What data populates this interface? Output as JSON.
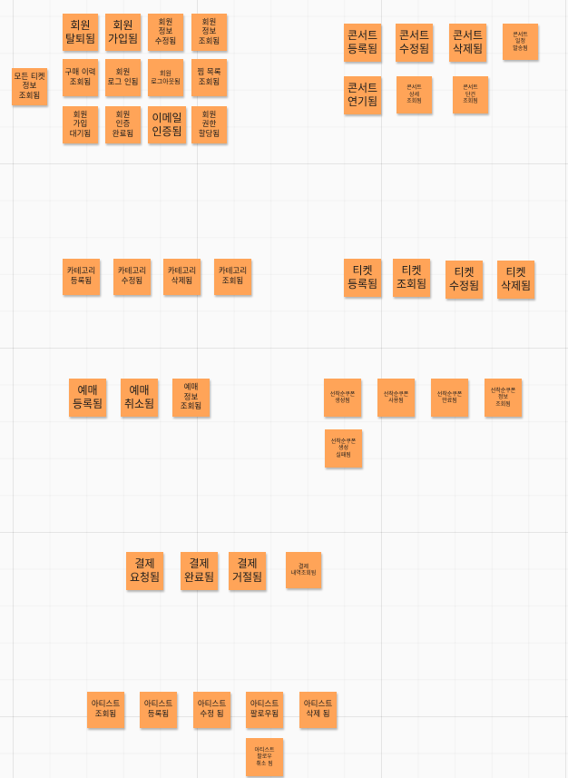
{
  "board": {
    "sticky_color": "#ffa458",
    "background_color": "#fafafa"
  },
  "stickies": {
    "member_withdrawn": "회원\n탈퇴됨",
    "member_joined": "회원\n가입됨",
    "member_info_modified": "회원\n정보\n수정됨",
    "member_info_viewed": "회원\n정보\n조회됨",
    "my_ticket_info_viewed": "모든 티켓\n정보\n조회됨",
    "purchase_history_viewed": "구매 이력\n조회됨",
    "member_logout_requested": "회원\n로그 인됨",
    "member_logged_out": "회원\n로그아웃됨",
    "favorite_list_viewed": "찜 목록\n조회됨",
    "member_signup_pending": "회원\n가입\n대기됨",
    "member_auth_completed": "회원\n인증\n완료됨",
    "email_verified": "이메일\n인증됨",
    "member_permission_assigned": "회원\n권한\n할당됨",
    "concert_registered": "콘서트\n등록됨",
    "concert_modified": "콘서트\n수정됨",
    "concert_deleted": "콘서트\n삭제됨",
    "concert_schedule_set": "콘서트\n일정\n발송됨",
    "concert_postponed": "콘서트\n연기됨",
    "concert_detail_viewed": "콘서트\n상세\n조회됨",
    "concert_list_viewed": "콘서트\n단건\n조회됨",
    "category_registered": "카테고리\n등록됨",
    "category_modified": "카테고리\n수정됨",
    "category_deleted": "카테고리\n삭제됨",
    "category_viewed": "카테고리\n조회됨",
    "ticket_registered": "티켓\n등록됨",
    "ticket_viewed": "티켓\n조회됨",
    "ticket_modified": "티켓\n수정됨",
    "ticket_deleted": "티켓\n삭제됨",
    "reservation_registered": "예매\n등록됨",
    "reservation_cancelled": "예매\n취소됨",
    "reservation_info_viewed": "예매\n정보\n조회됨",
    "coupon_created": "선착순쿠폰\n생성됨",
    "coupon_used": "선착순쿠폰\n사용됨",
    "coupon_cancelled": "선착순쿠폰\n만료됨",
    "coupon_info_viewed": "선착순쿠폰\n정보\n조회됨",
    "coupon_issue_failed": "선착순쿠폰\n생성\n실패됨",
    "payment_requested": "결제\n요청됨",
    "payment_completed": "결제\n완료됨",
    "payment_rejected": "결제\n거절됨",
    "payment_history_viewed": "결제\n내역조회됨",
    "artist_viewed": "아티스트\n조회됨",
    "artist_registered": "아티스트\n등록됨",
    "artist_modified": "아티스트\n수정 됨",
    "artist_followed": "아티스트\n팔로우됨",
    "artist_deleted": "아티스트\n삭제 됨",
    "artist_unfollowed": "아티스트\n팔로우\n취소 됨"
  }
}
